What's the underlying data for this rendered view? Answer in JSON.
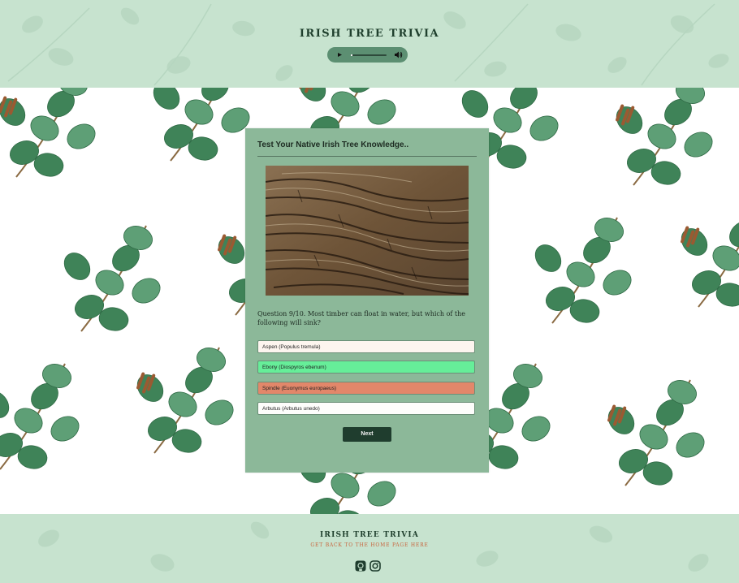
{
  "header": {
    "title": "IRISH TREE TRIVIA",
    "audio": {
      "progress_fraction": 0.05
    }
  },
  "quiz": {
    "heading": "Test Your Native Irish Tree Knowledge..",
    "question": "Question 9/10. Most timber can float in water, but which of the following will sink?",
    "answers": [
      {
        "label": "Aspen (Populus tremula)",
        "state": "default",
        "color": "#fdf5ef"
      },
      {
        "label": "Ebony (Diospyros ebenum)",
        "state": "correct",
        "color": "#66ee99"
      },
      {
        "label": "Spindle (Euonymus europaeus)",
        "state": "incorrect",
        "color": "#e2876a"
      },
      {
        "label": "Arbutus (Arbutus unedo)",
        "state": "default",
        "color": "#fdfdfb"
      }
    ],
    "next_label": "Next"
  },
  "footer": {
    "title": "IRISH TREE TRIVIA",
    "home_link": "GET BACK TO THE HOME PAGE HERE",
    "social": [
      "github-icon",
      "instagram-icon"
    ]
  },
  "colors": {
    "header_bg": "#c7e3cf",
    "card_bg": "#8cb899",
    "button_bg": "#1f3d2e",
    "link": "#c8623a"
  }
}
